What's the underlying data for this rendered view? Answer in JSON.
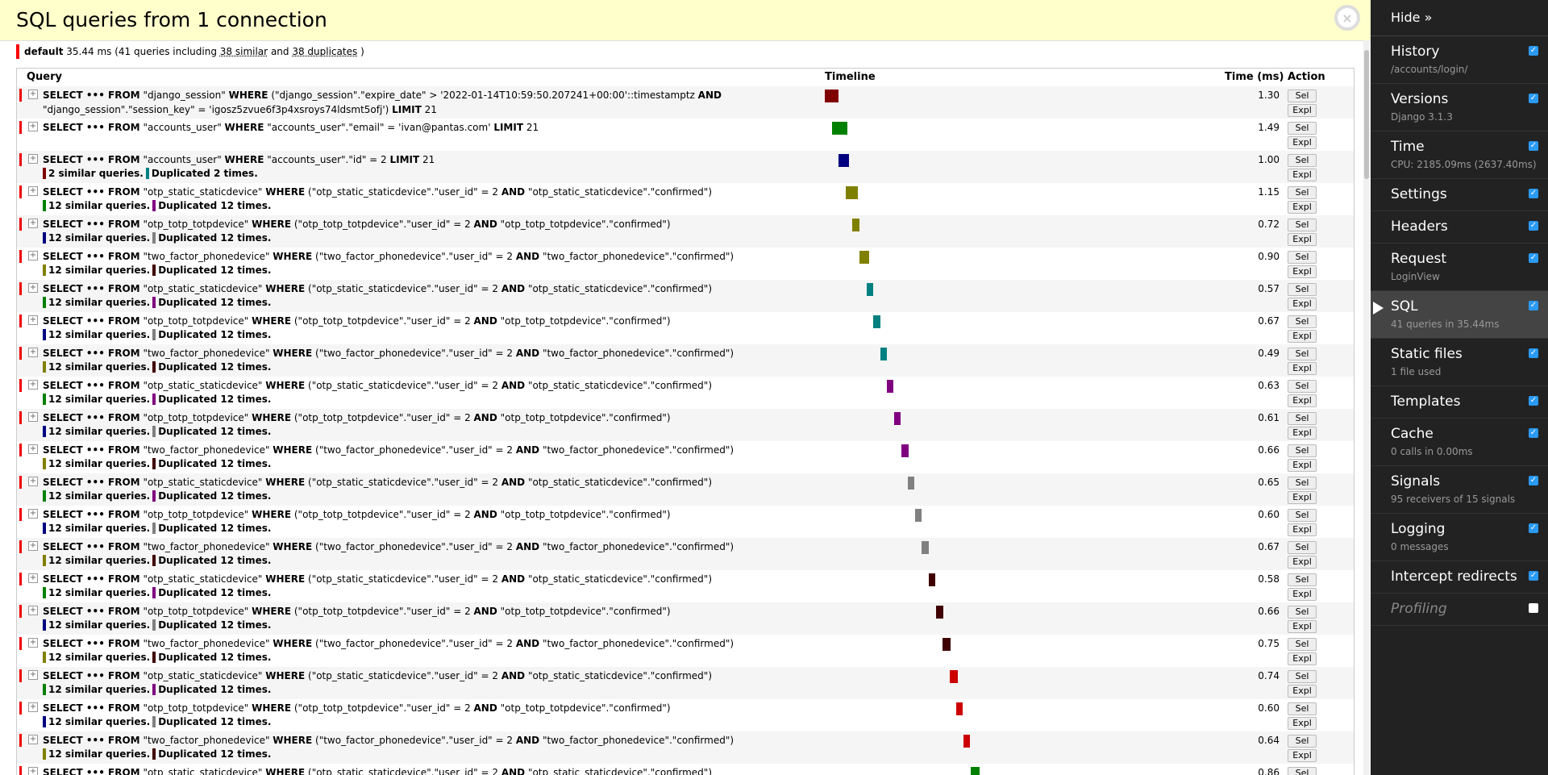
{
  "title": "SQL queries from 1 connection",
  "close_glyph": "×",
  "summary": {
    "alias": "default",
    "text1": "35.44 ms (41 queries including",
    "similar": "38 similar",
    "and": "and",
    "duplicates": "38 duplicates",
    "close": ")"
  },
  "columns": {
    "query": "Query",
    "timeline": "Timeline",
    "time": "Time (ms)",
    "action": "Action"
  },
  "buttons": {
    "sel": "Sel",
    "expl": "Expl"
  },
  "toggle_glyph": "+",
  "query_rows": [
    {
      "html": "<b>SELECT ••• FROM</b> \"django_session\" <b>WHERE</b> (\"django_session\".\"expire_date\" &gt; '2022-01-14T10:59:50.207241+00:00'::timestamptz <b>AND</b> \"django_session\".\"session_key\" = 'igosz5zvue6f3p4xsroys74ldsmt5ofj') <b>LIMIT</b> 21",
      "similar": "",
      "duplicated": "",
      "time": "1.30",
      "tl_color": "#800000",
      "sim_color": "",
      "dup_color": ""
    },
    {
      "html": "<b>SELECT ••• FROM</b> \"accounts_user\" <b>WHERE</b> \"accounts_user\".\"email\" = 'ivan@pantas.com' <b>LIMIT</b> 21",
      "similar": "",
      "duplicated": "",
      "time": "1.49",
      "tl_color": "#008000",
      "sim_color": "",
      "dup_color": ""
    },
    {
      "html": "<b>SELECT ••• FROM</b> \"accounts_user\" <b>WHERE</b> \"accounts_user\".\"id\" = 2 <b>LIMIT</b> 21",
      "similar": "2 similar queries.",
      "duplicated": "Duplicated 2 times.",
      "time": "1.00",
      "tl_color": "#000080",
      "sim_color": "#800000",
      "dup_color": "#008080"
    },
    {
      "html": "<b>SELECT ••• FROM</b> \"otp_static_staticdevice\" <b>WHERE</b> (\"otp_static_staticdevice\".\"user_id\" = 2 <b>AND</b> \"otp_static_staticdevice\".\"confirmed\")",
      "similar": "12 similar queries.",
      "duplicated": "Duplicated 12 times.",
      "time": "1.15",
      "tl_color": "#808000",
      "sim_color": "#008000",
      "dup_color": "#800080"
    },
    {
      "html": "<b>SELECT ••• FROM</b> \"otp_totp_totpdevice\" <b>WHERE</b> (\"otp_totp_totpdevice\".\"user_id\" = 2 <b>AND</b> \"otp_totp_totpdevice\".\"confirmed\")",
      "similar": "12 similar queries.",
      "duplicated": "Duplicated 12 times.",
      "time": "0.72",
      "tl_color": "#808000",
      "sim_color": "#000080",
      "dup_color": "#808080"
    },
    {
      "html": "<b>SELECT ••• FROM</b> \"two_factor_phonedevice\" <b>WHERE</b> (\"two_factor_phonedevice\".\"user_id\" = 2 <b>AND</b> \"two_factor_phonedevice\".\"confirmed\")",
      "similar": "12 similar queries.",
      "duplicated": "Duplicated 12 times.",
      "time": "0.90",
      "tl_color": "#808000",
      "sim_color": "#808000",
      "dup_color": "#400000"
    },
    {
      "html": "<b>SELECT ••• FROM</b> \"otp_static_staticdevice\" <b>WHERE</b> (\"otp_static_staticdevice\".\"user_id\" = 2 <b>AND</b> \"otp_static_staticdevice\".\"confirmed\")",
      "similar": "12 similar queries.",
      "duplicated": "Duplicated 12 times.",
      "time": "0.57",
      "tl_color": "#008080",
      "sim_color": "#008000",
      "dup_color": "#800080"
    },
    {
      "html": "<b>SELECT ••• FROM</b> \"otp_totp_totpdevice\" <b>WHERE</b> (\"otp_totp_totpdevice\".\"user_id\" = 2 <b>AND</b> \"otp_totp_totpdevice\".\"confirmed\")",
      "similar": "12 similar queries.",
      "duplicated": "Duplicated 12 times.",
      "time": "0.67",
      "tl_color": "#008080",
      "sim_color": "#000080",
      "dup_color": "#808080"
    },
    {
      "html": "<b>SELECT ••• FROM</b> \"two_factor_phonedevice\" <b>WHERE</b> (\"two_factor_phonedevice\".\"user_id\" = 2 <b>AND</b> \"two_factor_phonedevice\".\"confirmed\")",
      "similar": "12 similar queries.",
      "duplicated": "Duplicated 12 times.",
      "time": "0.49",
      "tl_color": "#008080",
      "sim_color": "#808000",
      "dup_color": "#400000"
    },
    {
      "html": "<b>SELECT ••• FROM</b> \"otp_static_staticdevice\" <b>WHERE</b> (\"otp_static_staticdevice\".\"user_id\" = 2 <b>AND</b> \"otp_static_staticdevice\".\"confirmed\")",
      "similar": "12 similar queries.",
      "duplicated": "Duplicated 12 times.",
      "time": "0.63",
      "tl_color": "#800080",
      "sim_color": "#008000",
      "dup_color": "#800080"
    },
    {
      "html": "<b>SELECT ••• FROM</b> \"otp_totp_totpdevice\" <b>WHERE</b> (\"otp_totp_totpdevice\".\"user_id\" = 2 <b>AND</b> \"otp_totp_totpdevice\".\"confirmed\")",
      "similar": "12 similar queries.",
      "duplicated": "Duplicated 12 times.",
      "time": "0.61",
      "tl_color": "#800080",
      "sim_color": "#000080",
      "dup_color": "#808080"
    },
    {
      "html": "<b>SELECT ••• FROM</b> \"two_factor_phonedevice\" <b>WHERE</b> (\"two_factor_phonedevice\".\"user_id\" = 2 <b>AND</b> \"two_factor_phonedevice\".\"confirmed\")",
      "similar": "12 similar queries.",
      "duplicated": "Duplicated 12 times.",
      "time": "0.66",
      "tl_color": "#800080",
      "sim_color": "#808000",
      "dup_color": "#400000"
    },
    {
      "html": "<b>SELECT ••• FROM</b> \"otp_static_staticdevice\" <b>WHERE</b> (\"otp_static_staticdevice\".\"user_id\" = 2 <b>AND</b> \"otp_static_staticdevice\".\"confirmed\")",
      "similar": "12 similar queries.",
      "duplicated": "Duplicated 12 times.",
      "time": "0.65",
      "tl_color": "#808080",
      "sim_color": "#008000",
      "dup_color": "#800080"
    },
    {
      "html": "<b>SELECT ••• FROM</b> \"otp_totp_totpdevice\" <b>WHERE</b> (\"otp_totp_totpdevice\".\"user_id\" = 2 <b>AND</b> \"otp_totp_totpdevice\".\"confirmed\")",
      "similar": "12 similar queries.",
      "duplicated": "Duplicated 12 times.",
      "time": "0.60",
      "tl_color": "#808080",
      "sim_color": "#000080",
      "dup_color": "#808080"
    },
    {
      "html": "<b>SELECT ••• FROM</b> \"two_factor_phonedevice\" <b>WHERE</b> (\"two_factor_phonedevice\".\"user_id\" = 2 <b>AND</b> \"two_factor_phonedevice\".\"confirmed\")",
      "similar": "12 similar queries.",
      "duplicated": "Duplicated 12 times.",
      "time": "0.67",
      "tl_color": "#808080",
      "sim_color": "#808000",
      "dup_color": "#400000"
    },
    {
      "html": "<b>SELECT ••• FROM</b> \"otp_static_staticdevice\" <b>WHERE</b> (\"otp_static_staticdevice\".\"user_id\" = 2 <b>AND</b> \"otp_static_staticdevice\".\"confirmed\")",
      "similar": "12 similar queries.",
      "duplicated": "Duplicated 12 times.",
      "time": "0.58",
      "tl_color": "#400000",
      "sim_color": "#008000",
      "dup_color": "#800080"
    },
    {
      "html": "<b>SELECT ••• FROM</b> \"otp_totp_totpdevice\" <b>WHERE</b> (\"otp_totp_totpdevice\".\"user_id\" = 2 <b>AND</b> \"otp_totp_totpdevice\".\"confirmed\")",
      "similar": "12 similar queries.",
      "duplicated": "Duplicated 12 times.",
      "time": "0.66",
      "tl_color": "#400000",
      "sim_color": "#000080",
      "dup_color": "#808080"
    },
    {
      "html": "<b>SELECT ••• FROM</b> \"two_factor_phonedevice\" <b>WHERE</b> (\"two_factor_phonedevice\".\"user_id\" = 2 <b>AND</b> \"two_factor_phonedevice\".\"confirmed\")",
      "similar": "12 similar queries.",
      "duplicated": "Duplicated 12 times.",
      "time": "0.75",
      "tl_color": "#400000",
      "sim_color": "#808000",
      "dup_color": "#400000"
    },
    {
      "html": "<b>SELECT ••• FROM</b> \"otp_static_staticdevice\" <b>WHERE</b> (\"otp_static_staticdevice\".\"user_id\" = 2 <b>AND</b> \"otp_static_staticdevice\".\"confirmed\")",
      "similar": "12 similar queries.",
      "duplicated": "Duplicated 12 times.",
      "time": "0.74",
      "tl_color": "#cc0000",
      "sim_color": "#008000",
      "dup_color": "#800080"
    },
    {
      "html": "<b>SELECT ••• FROM</b> \"otp_totp_totpdevice\" <b>WHERE</b> (\"otp_totp_totpdevice\".\"user_id\" = 2 <b>AND</b> \"otp_totp_totpdevice\".\"confirmed\")",
      "similar": "12 similar queries.",
      "duplicated": "Duplicated 12 times.",
      "time": "0.60",
      "tl_color": "#cc0000",
      "sim_color": "#000080",
      "dup_color": "#808080"
    },
    {
      "html": "<b>SELECT ••• FROM</b> \"two_factor_phonedevice\" <b>WHERE</b> (\"two_factor_phonedevice\".\"user_id\" = 2 <b>AND</b> \"two_factor_phonedevice\".\"confirmed\")",
      "similar": "12 similar queries.",
      "duplicated": "Duplicated 12 times.",
      "time": "0.64",
      "tl_color": "#cc0000",
      "sim_color": "#808000",
      "dup_color": "#400000"
    },
    {
      "html": "<b>SELECT ••• FROM</b> \"otp_static_staticdevice\" <b>WHERE</b> (\"otp_static_staticdevice\".\"user_id\" = 2 <b>AND</b> \"otp_static_staticdevice\".\"confirmed\")",
      "similar": "",
      "duplicated": "",
      "time": "0.86",
      "tl_color": "#008000",
      "sim_color": "",
      "dup_color": ""
    }
  ],
  "toolbar": {
    "hide_label": "Hide »",
    "panels": [
      {
        "title": "History",
        "subtitle": "/accounts/login/",
        "checked": true
      },
      {
        "title": "Versions",
        "subtitle": "Django 3.1.3",
        "checked": true
      },
      {
        "title": "Time",
        "subtitle": "CPU: 2185.09ms (2637.40ms)",
        "checked": true
      },
      {
        "title": "Settings",
        "subtitle": "",
        "checked": true
      },
      {
        "title": "Headers",
        "subtitle": "",
        "checked": true
      },
      {
        "title": "Request",
        "subtitle": "LoginView",
        "checked": true
      },
      {
        "title": "SQL",
        "subtitle": "41 queries in 35.44ms",
        "checked": true,
        "active": true
      },
      {
        "title": "Static files",
        "subtitle": "1 file used",
        "checked": true
      },
      {
        "title": "Templates",
        "subtitle": "",
        "checked": true
      },
      {
        "title": "Cache",
        "subtitle": "0 calls in 0.00ms",
        "checked": true
      },
      {
        "title": "Signals",
        "subtitle": "95 receivers of 15 signals",
        "checked": true
      },
      {
        "title": "Logging",
        "subtitle": "0 messages",
        "checked": true
      },
      {
        "title": "Intercept redirects",
        "subtitle": "",
        "checked": true
      },
      {
        "title": "Profiling",
        "subtitle": "",
        "checked": false,
        "disabled": true
      }
    ]
  },
  "colors": {
    "title_bg": "#ffffcc",
    "toolbar_bg": "#222222",
    "active_panel": "#444444",
    "checkbox": "#2b9af3",
    "summary_bar": "#ff0000"
  }
}
